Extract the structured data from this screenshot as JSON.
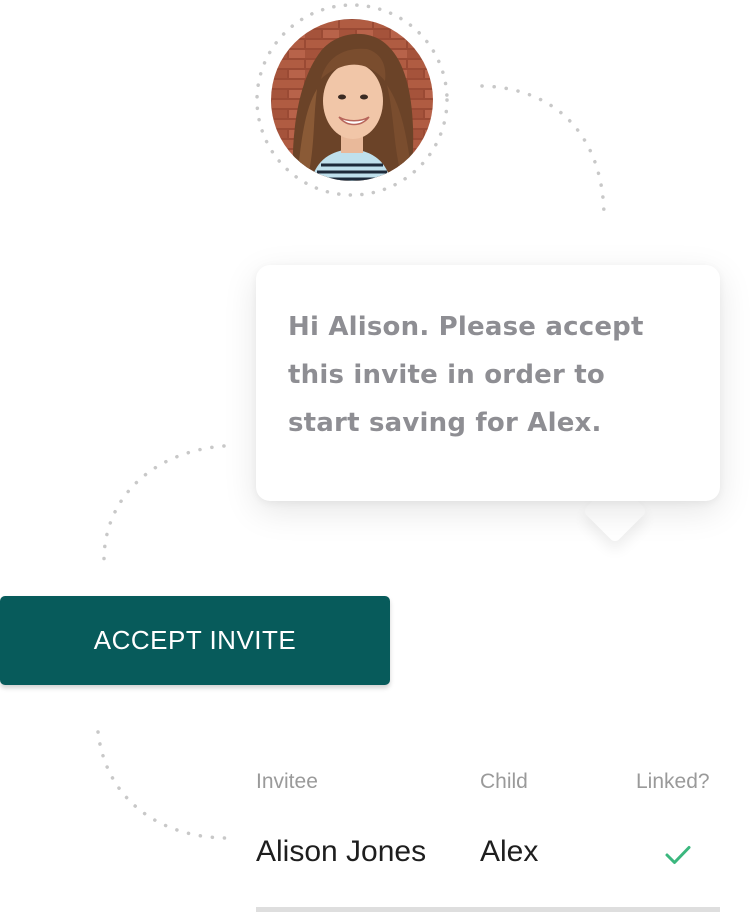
{
  "bubble": {
    "lines": [
      "Hi Alison. Please accept",
      "this invite in order to",
      "start saving for Alex."
    ]
  },
  "accept_button": {
    "label": "ACCEPT INVITE"
  },
  "table": {
    "headers": {
      "invitee": "Invitee",
      "child": "Child",
      "linked": "Linked?"
    },
    "rows": [
      {
        "invitee": "Alison Jones",
        "child": "Alex",
        "linked": true
      }
    ]
  },
  "colors": {
    "primary_button": "#075b5b",
    "check": "#3bb77e",
    "bubble_text": "#8e8e93",
    "header_text": "#9a9a9a",
    "dotted_line": "#c8c8c8"
  },
  "icons": {
    "linked_status": "checkmark-icon"
  }
}
